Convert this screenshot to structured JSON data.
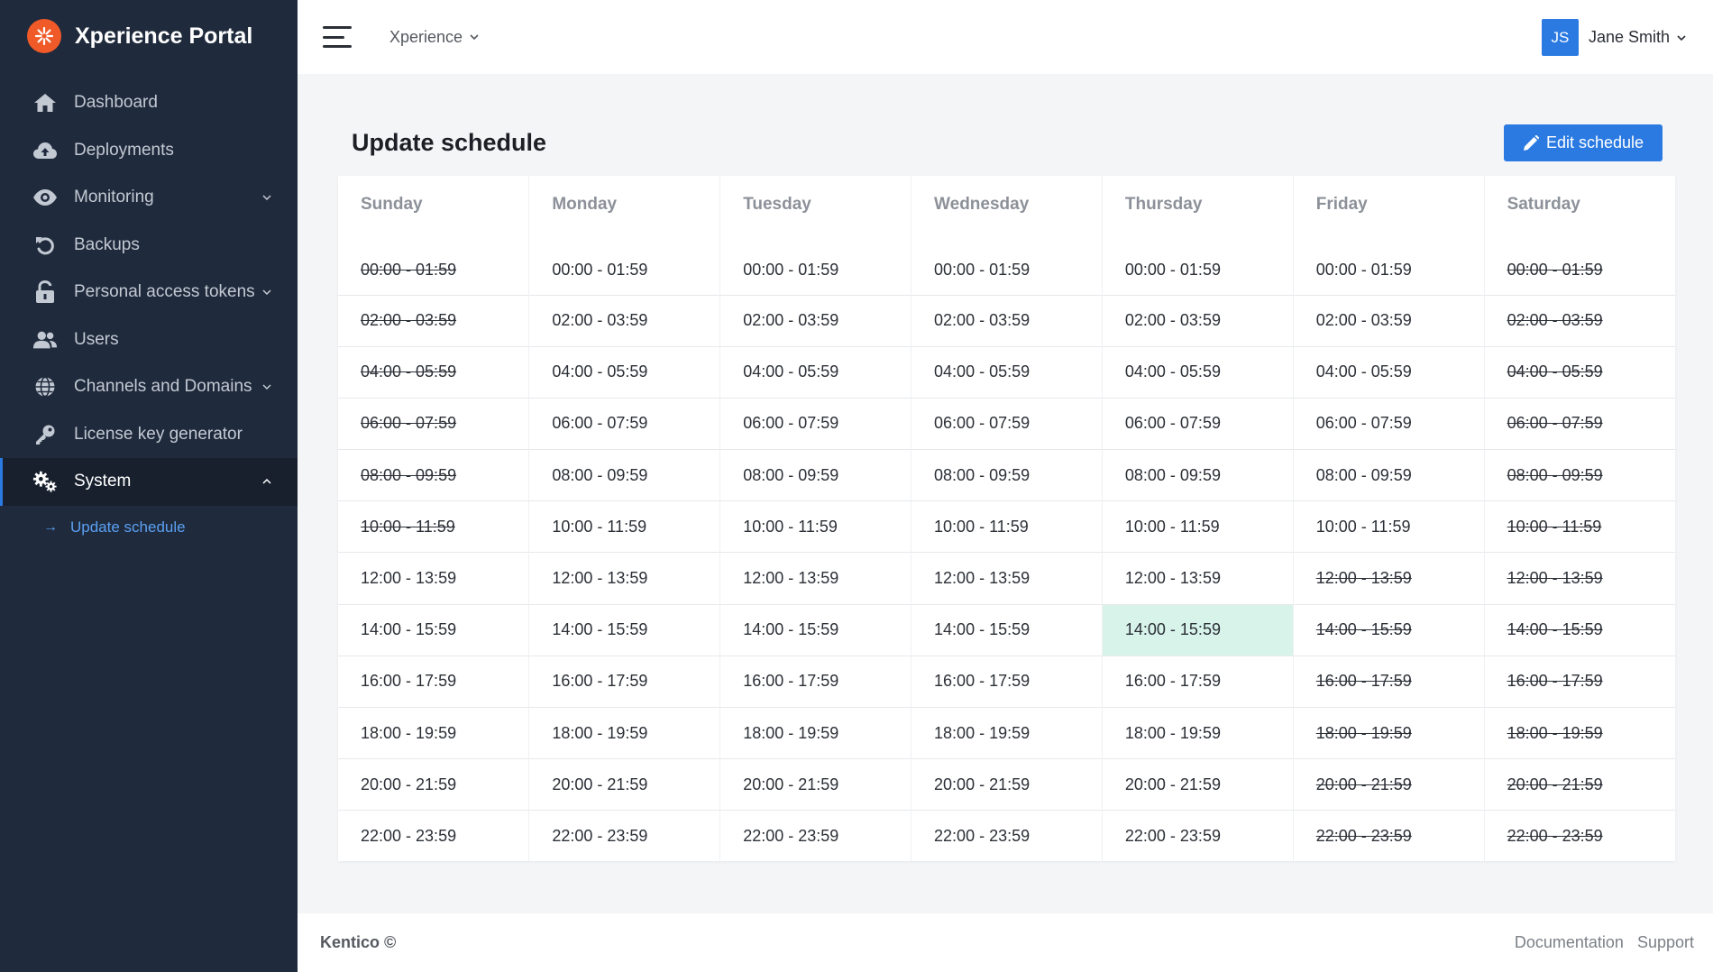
{
  "app": {
    "title": "Xperience Portal",
    "brand_color": "#f05a28",
    "accent_color": "#2a7ae2"
  },
  "sidebar": {
    "items": [
      {
        "label": "Dashboard",
        "icon": "home-icon",
        "expandable": false
      },
      {
        "label": "Deployments",
        "icon": "cloud-upload-icon",
        "expandable": false
      },
      {
        "label": "Monitoring",
        "icon": "eye-icon",
        "expandable": true
      },
      {
        "label": "Backups",
        "icon": "undo-icon",
        "expandable": false
      },
      {
        "label": "Personal access tokens",
        "icon": "lock-icon",
        "expandable": true
      },
      {
        "label": "Users",
        "icon": "users-icon",
        "expandable": false
      },
      {
        "label": "Channels and Domains",
        "icon": "globe-icon",
        "expandable": true
      },
      {
        "label": "License key generator",
        "icon": "key-icon",
        "expandable": false
      },
      {
        "label": "System",
        "icon": "gears-icon",
        "expandable": true,
        "active": true
      }
    ],
    "subitems": [
      {
        "label": "Update schedule",
        "icon": "arrow-right-icon"
      }
    ]
  },
  "header": {
    "project": "Xperience",
    "user": {
      "initials": "JS",
      "name": "Jane Smith"
    }
  },
  "main": {
    "title": "Update schedule",
    "edit_button": "Edit schedule"
  },
  "schedule": {
    "days": [
      "Sunday",
      "Monday",
      "Tuesday",
      "Wednesday",
      "Thursday",
      "Friday",
      "Saturday"
    ],
    "slots": [
      "00:00 - 01:59",
      "02:00 - 03:59",
      "04:00 - 05:59",
      "06:00 - 07:59",
      "08:00 - 09:59",
      "10:00 - 11:59",
      "12:00 - 13:59",
      "14:00 - 15:59",
      "16:00 - 17:59",
      "18:00 - 19:59",
      "20:00 - 21:59",
      "22:00 - 23:59"
    ],
    "enabled": [
      [
        false,
        true,
        true,
        true,
        true,
        true,
        false
      ],
      [
        false,
        true,
        true,
        true,
        true,
        true,
        false
      ],
      [
        false,
        true,
        true,
        true,
        true,
        true,
        false
      ],
      [
        false,
        true,
        true,
        true,
        true,
        true,
        false
      ],
      [
        false,
        true,
        true,
        true,
        true,
        true,
        false
      ],
      [
        false,
        true,
        true,
        true,
        true,
        true,
        false
      ],
      [
        true,
        true,
        true,
        true,
        true,
        false,
        false
      ],
      [
        true,
        true,
        true,
        true,
        true,
        false,
        false
      ],
      [
        true,
        true,
        true,
        true,
        true,
        false,
        false
      ],
      [
        true,
        true,
        true,
        true,
        true,
        false,
        false
      ],
      [
        true,
        true,
        true,
        true,
        true,
        false,
        false
      ],
      [
        true,
        true,
        true,
        true,
        true,
        false,
        false
      ]
    ],
    "current": {
      "row": 7,
      "col": 4
    },
    "current_color": "#d7f3ea"
  },
  "footer": {
    "brand": "Kentico ©",
    "links": [
      "Documentation",
      "Support"
    ]
  }
}
